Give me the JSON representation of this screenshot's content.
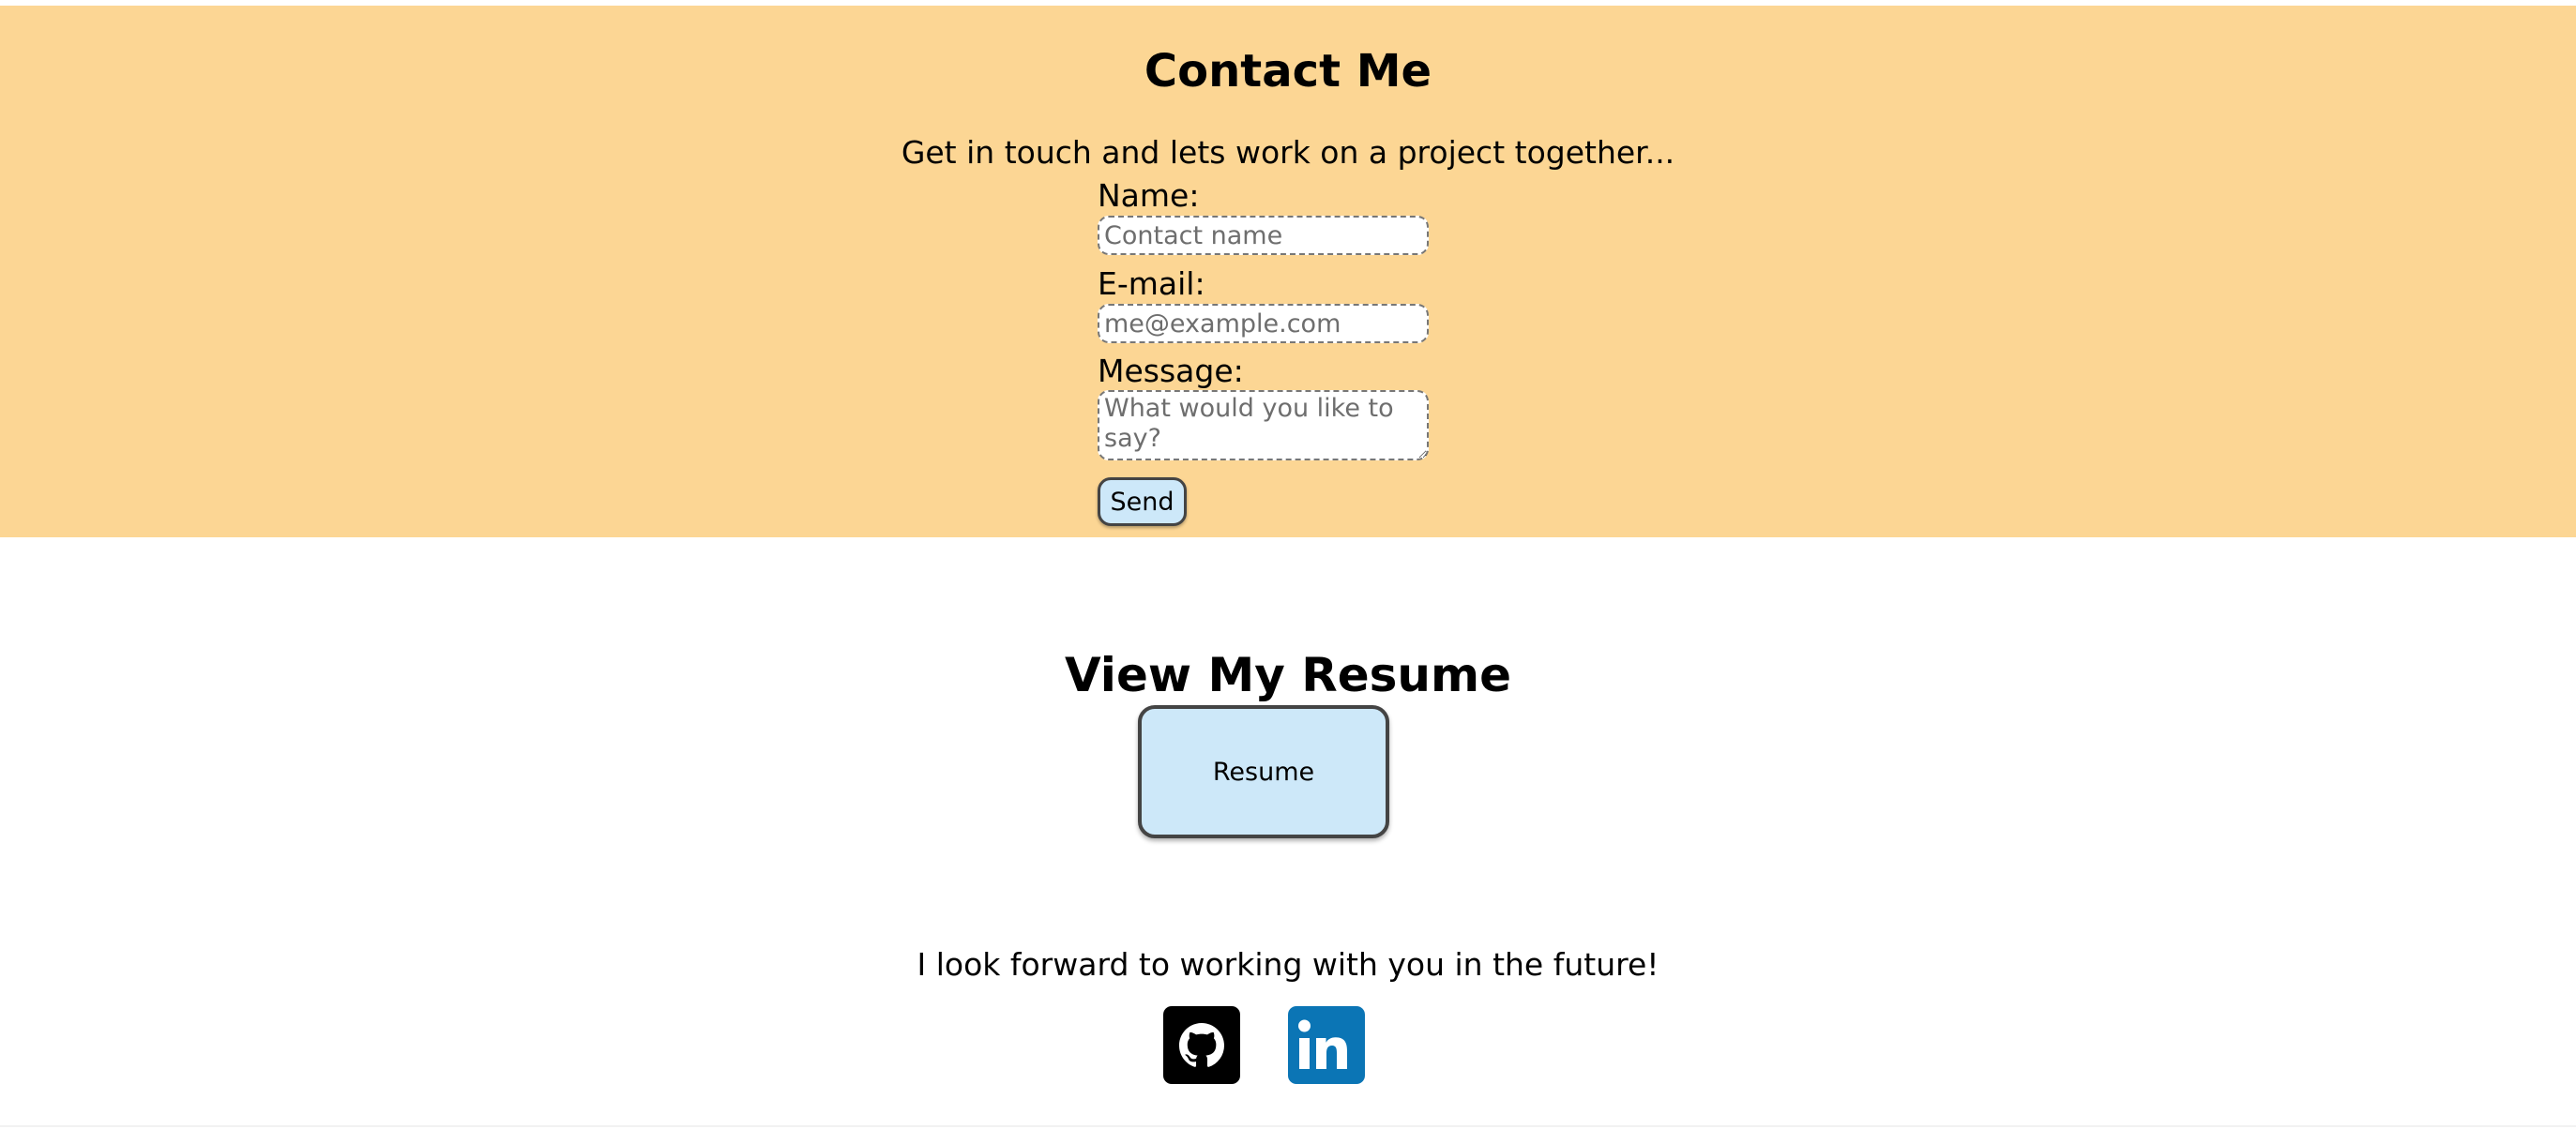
{
  "contact": {
    "title": "Contact Me",
    "subtitle": "Get in touch and lets work on a project together...",
    "name_label": "Name:",
    "name_placeholder": "Contact name",
    "email_label": "E-mail:",
    "email_placeholder": "me@example.com",
    "message_label": "Message:",
    "message_placeholder": "What would you like to say?",
    "send_label": "Send",
    "background_color": "#fcd694"
  },
  "resume": {
    "title": "View My Resume",
    "button_label": "Resume",
    "button_color": "#cde8f9"
  },
  "footer": {
    "closing_text": "I look forward to working with you in the future!",
    "social": [
      {
        "icon": "github-icon",
        "color": "#000000"
      },
      {
        "icon": "linkedin-icon",
        "color": "#0b75b5"
      }
    ]
  }
}
